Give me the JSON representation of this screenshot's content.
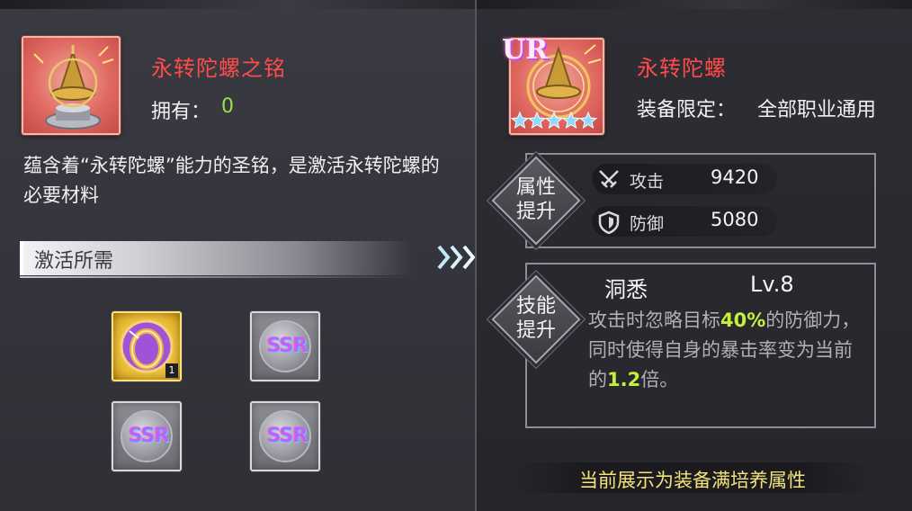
{
  "left": {
    "item_name": "永转陀螺之铭",
    "owned_label": "拥有：",
    "owned_count": "0",
    "description": "蕴含着“永转陀螺”能力的圣铭，是激活永转陀螺的必要材料",
    "section_title": "激活所需",
    "materials": [
      {
        "type": "ring-item",
        "count": "1"
      },
      {
        "type": "SSR"
      },
      {
        "type": "SSR"
      },
      {
        "type": "SSR"
      }
    ]
  },
  "right": {
    "rarity_badge": "UR",
    "equip_name": "永转陀螺",
    "restriction_label": "装备限定：",
    "restriction_value": "全部职业通用",
    "star_count": 5,
    "attr_section_label": [
      "属性",
      "提升"
    ],
    "stats": [
      {
        "icon": "crossed-swords-icon",
        "label": "攻击",
        "value": "9420"
      },
      {
        "icon": "shield-icon",
        "label": "防御",
        "value": "5080"
      }
    ],
    "skill_section_label": [
      "技能",
      "提升"
    ],
    "skill": {
      "name": "洞悉",
      "level": "Lv.8",
      "desc_part1": "攻击时忽略目标",
      "desc_hl1": "40%",
      "desc_part2": "的防御力，同时使得自身的暴击率变为当前的",
      "desc_hl2": "1.2",
      "desc_part3": "倍。"
    },
    "footer_note": "当前展示为装备满培养属性"
  },
  "colors": {
    "title_red": "#ff4a4a",
    "owned_green": "#9be24a",
    "highlight_green": "#c5f03a",
    "footer_yellow": "#f5e27a"
  }
}
